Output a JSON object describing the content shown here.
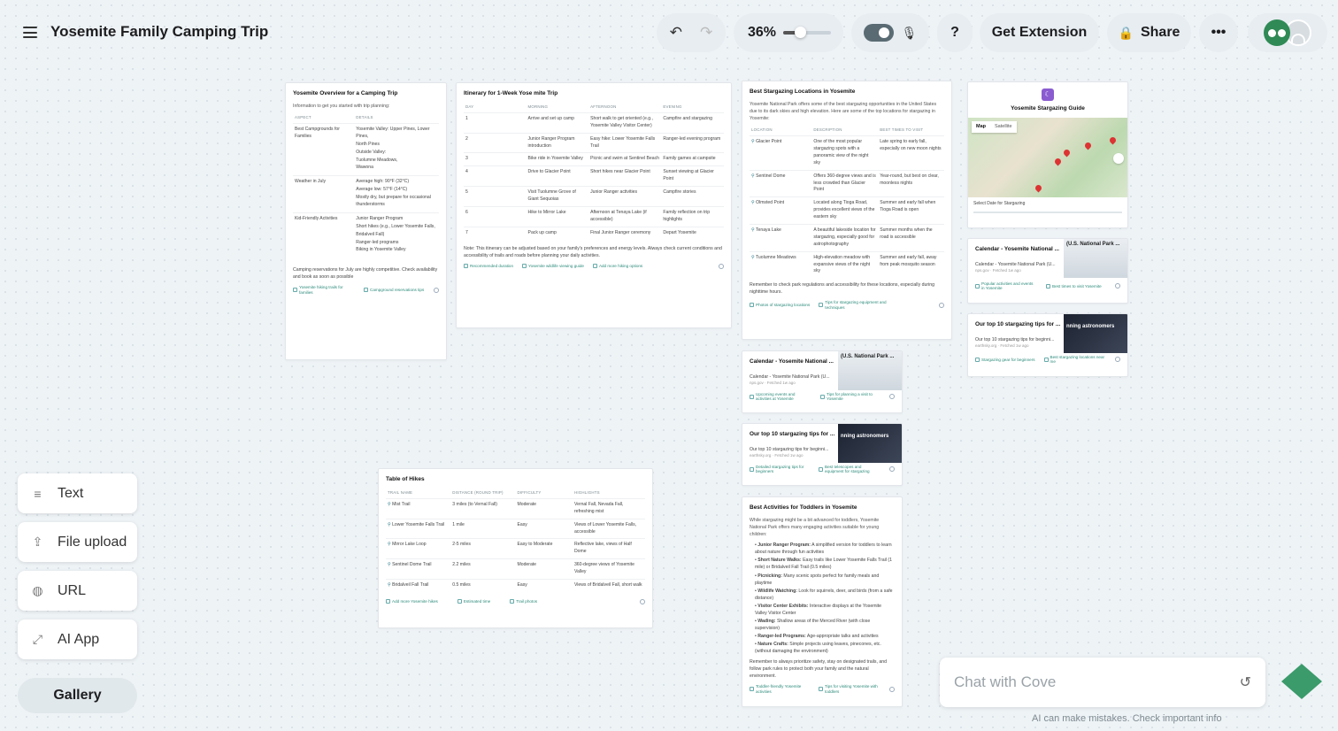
{
  "header": {
    "title": "Yosemite Family Camping Trip",
    "zoom": "36%",
    "zoom_level": 0.36,
    "get_extension": "Get Extension",
    "share": "Share"
  },
  "overview": {
    "title": "Yosemite Overview for a Camping Trip",
    "subtitle": "Information to get you started with trip planning:",
    "col_aspect": "ASPECT",
    "col_details": "DETAILS",
    "rows": [
      {
        "aspect": "Best Campgrounds for Families",
        "details": [
          "Yosemite Valley: Upper Pines, Lower Pines,",
          "North Pines",
          "Outside Valley:",
          "Tuolumne Meadows,",
          "Wawona"
        ]
      },
      {
        "aspect": "Weather in July",
        "details": [
          "Average high: 90°F (32°C)",
          "Average low: 57°F (14°C)",
          "Mostly dry, but prepare for occasional thunderstorms"
        ]
      },
      {
        "aspect": "Kid-Friendly Activities",
        "details": [
          "Junior Ranger Program",
          "Short hikes (e.g., Lower Yosemite Falls,",
          "Bridalveil Fall)",
          "Ranger-led programs",
          "Biking in Yosemite Valley"
        ]
      }
    ],
    "note": "Camping reservations for July are highly competitive. Check availability and book as soon as possible",
    "chip1": "Yosemite hiking trails for families",
    "chip2": "Campground reservations tips"
  },
  "itinerary": {
    "title": "Itinerary for 1-Week Yose mite Trip",
    "cols": [
      "DAY",
      "MORNING",
      "AFTERNOON",
      "EVENING"
    ],
    "rows": [
      [
        "1",
        "Arrive and set up camp",
        "Short walk to get oriented (e.g., Yosemite Valley Visitor Center)",
        "Campfire and stargazing"
      ],
      [
        "2",
        "Junior Ranger Program introduction",
        "Easy hike: Lower Yosemite Falls Trail",
        "Ranger-led evening program"
      ],
      [
        "3",
        "Bike ride in Yosemite Valley",
        "Picnic and swim at Sentinel Beach",
        "Family games at campsite"
      ],
      [
        "4",
        "Drive to Glacier Point",
        "Short hikes near Glacier Point",
        "Sunset viewing at Glacier Point"
      ],
      [
        "5",
        "Visit Tuolumne Grove of Giant Sequoias",
        "Junior Ranger activities",
        "Campfire stories"
      ],
      [
        "6",
        "Hike to Mirror Lake",
        "Afternoon at Tenaya Lake (if accessible)",
        "Family reflection on trip highlights"
      ],
      [
        "7",
        "Pack up camp",
        "Final Junior Ranger ceremony",
        "Depart Yosemite"
      ]
    ],
    "note": "Note: This itinerary can be adjusted based on your family's preferences and energy levels. Always check current conditions and accessibility of trails and roads before planning your daily activities.",
    "chip1": "Recommended duration",
    "chip2": "Yosemite wildlife viewing guide",
    "chip3": "Add more hiking options"
  },
  "stargazing": {
    "title": "Best Stargazing Locations in Yosemite",
    "intro": "Yosemite National Park offers some of the best stargazing opportunities in the United States due to its dark skies and high elevation. Here are some of the top locations for stargazing in Yosemite:",
    "cols": [
      "LOCATION",
      "DESCRIPTION",
      "BEST TIMES TO VISIT"
    ],
    "rows": [
      [
        "Glacier Point",
        "One of the most popular stargazing spots with a panoramic view of the night sky",
        "Late spring to early fall, especially on new moon nights"
      ],
      [
        "Sentinel Dome",
        "Offers 360-degree views and is less crowded than Glacier Point",
        "Year-round, but best on clear, moonless nights"
      ],
      [
        "Olmsted Point",
        "Located along Tioga Road, provides excellent views of the eastern sky",
        "Summer and early fall when Tioga Road is open"
      ],
      [
        "Tenaya Lake",
        "A beautiful lakeside location for stargazing, especially good for astrophotography",
        "Summer months when the road is accessible"
      ],
      [
        "Tuolumne Meadows",
        "High-elevation meadow with expansive views of the night sky",
        "Summer and early fall, away from peak mosquito season"
      ]
    ],
    "note": "Remember to check park regulations and accessibility for these locations, especially during nighttime hours.",
    "chip1": "Photos of stargazing locations",
    "chip2": "Tips for stargazing equipment and techniques"
  },
  "guide": {
    "title": "Yosemite Stargazing Guide",
    "map_tab": "Map",
    "sat_tab": "Satellite",
    "select_label": "Select Date for Stargazing"
  },
  "cal_right": {
    "title": "Calendar - Yosemite National ...",
    "thumb": "(U.S. National Park ...",
    "line": "Calendar - Yosemite National Park (U...",
    "meta": "nps.gov · Fetched 1w ago",
    "chip1": "Popular activities and events in Yosemite",
    "chip2": "Best times to visit Yosemite"
  },
  "tips_right": {
    "title": "Our top 10 stargazing tips for ...",
    "thumb": "nning astronomers",
    "line": "Our top 10 stargazing tips for beginni...",
    "meta": "earthsky.org · Fetched 1w ago",
    "chip1": "Stargazing gear for beginners",
    "chip2": "Best stargazing locations near me"
  },
  "cal_mid": {
    "title": "Calendar - Yosemite National ...",
    "thumb": "(U.S. National Park ...",
    "line": "Calendar - Yosemite National Park (U...",
    "meta": "nps.gov · Fetched 1w ago",
    "chip1": "Upcoming events and activities at Yosemite",
    "chip2": "Tips for planning a visit to Yosemite"
  },
  "tips_mid": {
    "title": "Our top 10 stargazing tips for ...",
    "thumb": "nning astronomers",
    "line": "Our top 10 stargazing tips for beginni...",
    "meta": "earthsky.org · Fetched 1w ago",
    "chip1": "Detailed stargazing tips for beginners",
    "chip2": "Best telescopes and equipment for stargazing"
  },
  "toddlers": {
    "title": "Best Activities for Toddlers in Yosemite",
    "intro": "While stargazing might be a bit advanced for toddlers, Yosemite National Park offers many engaging activities suitable for young children:",
    "items": [
      {
        "b": "Junior Ranger Program:",
        "t": " A simplified version for toddlers to learn about nature through fun activities"
      },
      {
        "b": "Short Nature Walks:",
        "t": " Easy trails like Lower Yosemite Falls Trail (1 mile) or Bridalveil Fall Trail (0.5 miles)"
      },
      {
        "b": "Picnicking:",
        "t": " Many scenic spots perfect for family meals and playtime"
      },
      {
        "b": "Wildlife Watching:",
        "t": " Look for squirrels, deer, and birds (from a safe distance)"
      },
      {
        "b": "Visitor Center Exhibits:",
        "t": " Interactive displays at the Yosemite Valley Visitor Center"
      },
      {
        "b": "Wading:",
        "t": " Shallow areas of the Merced River (with close supervision)"
      },
      {
        "b": "Ranger-led Programs:",
        "t": " Age-appropriate talks and activities"
      },
      {
        "b": "Nature Crafts:",
        "t": " Simple projects using leaves, pinecones, etc. (without damaging the environment)"
      }
    ],
    "note": "Remember to always prioritize safety, stay on designated trails, and follow park rules to protect both your family and the natural environment.",
    "chip1": "Toddler-friendly Yosemite activities",
    "chip2": "Tips for visiting Yosemite with toddlers"
  },
  "hikes": {
    "title": "Table of Hikes",
    "cols": [
      "TRAIL NAME",
      "DISTANCE (ROUND TRIP)",
      "DIFFICULTY",
      "HIGHLIGHTS"
    ],
    "rows": [
      [
        "Mist Trail",
        "3 miles (to Vernal Fall)",
        "Moderate",
        "Vernal Fall, Nevada Fall, refreshing mist"
      ],
      [
        "Lower Yosemite Falls Trail",
        "1 mile",
        "Easy",
        "Views of Lower Yosemite Falls, accessible"
      ],
      [
        "Mirror Lake Loop",
        "2-5 miles",
        "Easy to Moderate",
        "Reflective lake, views of Half Dome"
      ],
      [
        "Sentinel Dome Trail",
        "2.2 miles",
        "Moderate",
        "360-degree views of Yosemite Valley"
      ],
      [
        "Bridalveil Fall Trail",
        "0.5 miles",
        "Easy",
        "Views of Bridalveil Fall, short walk"
      ]
    ],
    "chip1": "Add more Yosemite hikes",
    "chip2": "Estimated time",
    "chip3": "Trail photos"
  },
  "sidebar": {
    "text": "Text",
    "file": "File upload",
    "url": "URL",
    "aiapp": "AI App",
    "gallery": "Gallery"
  },
  "chat": {
    "placeholder": "Chat with Cove",
    "disclaimer": "AI can make mistakes. Check important info"
  }
}
